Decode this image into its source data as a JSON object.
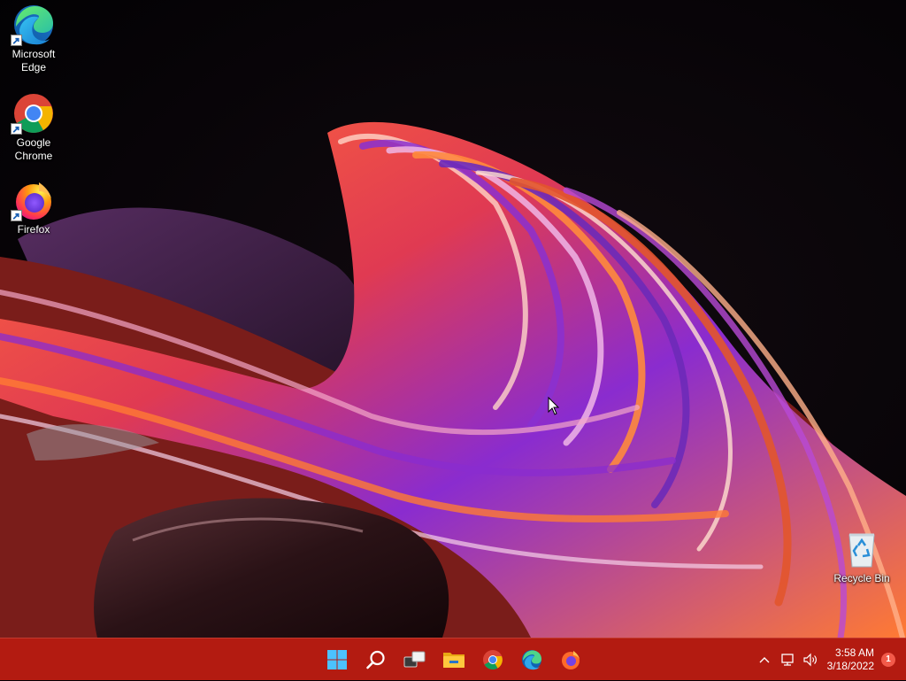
{
  "desktop": {
    "icons": [
      {
        "label": "Microsoft\nEdge",
        "icon": "edge-icon",
        "shortcut": true
      },
      {
        "label": "Google\nChrome",
        "icon": "chrome-icon",
        "shortcut": true
      },
      {
        "label": "Firefox",
        "icon": "firefox-icon",
        "shortcut": true
      },
      {
        "label": "Recycle Bin",
        "icon": "recycle-bin-icon",
        "shortcut": false
      }
    ]
  },
  "taskbar": {
    "color": "#b31b11",
    "pinned": [
      {
        "icon": "windows-start-icon"
      },
      {
        "icon": "search-icon"
      },
      {
        "icon": "task-view-icon"
      },
      {
        "icon": "file-explorer-icon"
      },
      {
        "icon": "chrome-icon"
      },
      {
        "icon": "edge-icon"
      },
      {
        "icon": "firefox-icon"
      }
    ],
    "tray": {
      "icons": [
        "chevron-up-icon",
        "network-icon",
        "volume-icon"
      ],
      "time": "3:58 AM",
      "date": "3/18/2022",
      "notification_count": "1"
    }
  }
}
